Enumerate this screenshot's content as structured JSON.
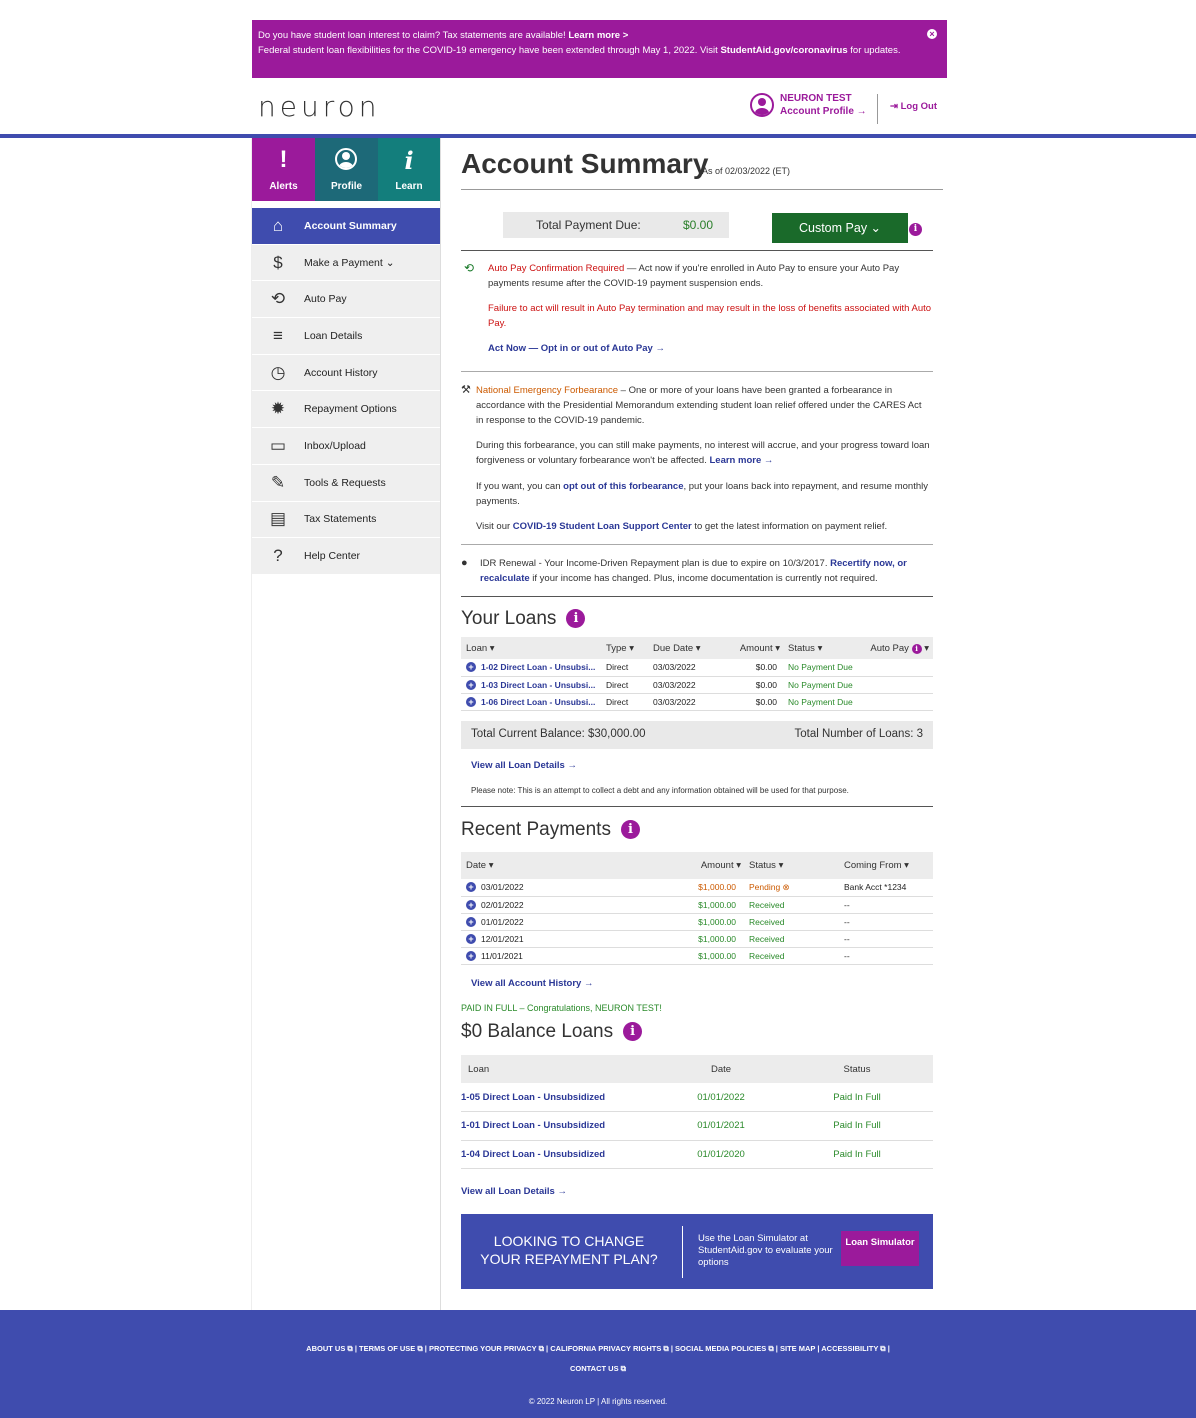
{
  "banner": {
    "line1_text": "Do you have student loan interest to claim? Tax statements are available!",
    "line1_link": "Learn more >",
    "line2_text": "Federal student loan flexibilities for the COVID-19 emergency have been extended through May 1, 2022. Visit",
    "line2_link": "StudentAid.gov/coronavirus",
    "line2_after": "for updates.",
    "close": "×"
  },
  "header": {
    "logo": "neuron",
    "user_name": "NEURON TEST",
    "account_profile": "Account Profile →",
    "logout": "⇥ Log Out"
  },
  "tiles": [
    {
      "label": "Alerts",
      "glyph": "!"
    },
    {
      "label": "Profile"
    },
    {
      "label": "Learn",
      "glyph": "i"
    }
  ],
  "menu": [
    {
      "label": "Account Summary",
      "icon": "⌂"
    },
    {
      "label": "Make a Payment ⌄",
      "icon": "$"
    },
    {
      "label": "Auto Pay",
      "icon": "⟲"
    },
    {
      "label": "Loan Details",
      "icon": "≡"
    },
    {
      "label": "Account History",
      "icon": "◷"
    },
    {
      "label": "Repayment Options",
      "icon": "✹"
    },
    {
      "label": "Inbox/Upload",
      "icon": "▭"
    },
    {
      "label": "Tools & Requests",
      "icon": "✎"
    },
    {
      "label": "Tax Statements",
      "icon": "▤"
    },
    {
      "label": "Help Center",
      "icon": "?"
    }
  ],
  "summary": {
    "title": "Account Summary",
    "as_of": "As of 02/03/2022 (ET)",
    "total_due_label": "Total Payment Due:",
    "total_due_value": "$0.00",
    "custom_pay": "Custom Pay ⌄",
    "info": "i"
  },
  "autopay": {
    "title": "Auto Pay Confirmation Required",
    "text": " — Act now if you're enrolled in Auto Pay to ensure your Auto Pay payments resume after the COVID-19 payment suspension ends.",
    "warning": "Failure to act will result in Auto Pay termination and may result in the loss of benefits associated with Auto Pay.",
    "link": "Act Now — Opt in or out of Auto Pay →"
  },
  "forbearance": {
    "title": "National Emergency Forbearance",
    "text1": " – One or more of your loans have been granted a forbearance in accordance with the Presidential Memorandum extending student loan relief offered under the CARES Act in response to the COVID-19 pandemic.",
    "text2": "During this forbearance, you can still make payments, no interest will accrue, and your progress toward loan forgiveness or voluntary forbearance won't be affected.",
    "learn_more": "Learn more →",
    "text3a": "If you want, you can",
    "opt_out": "opt out of this forbearance",
    "text3b": ", put your loans back into repayment, and resume monthly payments.",
    "text4a": "Visit our",
    "support_link": "COVID-19 Student Loan Support Center",
    "text4b": "to get the latest information on payment relief."
  },
  "idr": {
    "text": "IDR Renewal - Your Income-Driven Repayment plan is due to expire on 10/3/2017.",
    "link": "Recertify now, or recalculate",
    "after": "if your income has changed. Plus, income documentation is currently not required."
  },
  "your_loans": {
    "heading": "Your Loans",
    "columns": [
      "Loan ▾",
      "Type ▾",
      "Due Date ▾",
      "Amount ▾",
      "Status ▾",
      "Auto Pay"
    ],
    "rows": [
      {
        "loan": "1-02 Direct Loan - Unsubsi...",
        "type": "Direct",
        "due": "03/03/2022",
        "amount": "$0.00",
        "status": "No Payment Due"
      },
      {
        "loan": "1-03 Direct Loan - Unsubsi...",
        "type": "Direct",
        "due": "03/03/2022",
        "amount": "$0.00",
        "status": "No Payment Due"
      },
      {
        "loan": "1-06 Direct Loan - Unsubsi...",
        "type": "Direct",
        "due": "03/03/2022",
        "amount": "$0.00",
        "status": "No Payment Due"
      }
    ],
    "balance_label": "Total Current Balance:  $30,000.00",
    "count_label": "Total Number of Loans:  3",
    "view_all": "View all Loan Details →",
    "note": "Please note: This is an attempt to collect a debt and any information obtained will be used for that purpose."
  },
  "recent_payments": {
    "heading": "Recent Payments",
    "columns": [
      "Date ▾",
      "Amount ▾",
      "Status ▾",
      "Coming From ▾"
    ],
    "rows": [
      {
        "date": "03/01/2022",
        "amount": "$1,000.00",
        "status": "Pending ⊗",
        "from": "Bank Acct *1234"
      },
      {
        "date": "02/01/2022",
        "amount": "$1,000.00",
        "status": "Received",
        "from": "--"
      },
      {
        "date": "01/01/2022",
        "amount": "$1,000.00",
        "status": "Received",
        "from": "--"
      },
      {
        "date": "12/01/2021",
        "amount": "$1,000.00",
        "status": "Received",
        "from": "--"
      },
      {
        "date": "11/01/2021",
        "amount": "$1,000.00",
        "status": "Received",
        "from": "--"
      }
    ],
    "view_all": "View all Account History →"
  },
  "zero_balance": {
    "paid_msg": "PAID IN FULL – Congratulations, NEURON TEST!",
    "heading": "$0 Balance Loans",
    "columns": [
      "Loan",
      "Date",
      "Status"
    ],
    "rows": [
      {
        "loan": "1-05 Direct Loan - Unsubsidized",
        "date": "01/01/2022",
        "status": "Paid In Full"
      },
      {
        "loan": "1-01 Direct Loan - Unsubsidized",
        "date": "01/01/2021",
        "status": "Paid In Full"
      },
      {
        "loan": "1-04 Direct Loan - Unsubsidized",
        "date": "01/01/2020",
        "status": "Paid In Full"
      }
    ],
    "view_all": "View all Loan Details →"
  },
  "promo": {
    "headline": "LOOKING TO CHANGE YOUR REPAYMENT PLAN?",
    "text": "Use the Loan Simulator at StudentAid.gov to evaluate your options",
    "button": "Loan Simulator"
  },
  "footer": {
    "links_line1": "ABOUT US ⧉  |  TERMS OF USE ⧉  |  PROTECTING YOUR PRIVACY ⧉  |  CALIFORNIA PRIVACY RIGHTS ⧉  |  SOCIAL MEDIA POLICIES ⧉  |  SITE MAP  |  ACCESSIBILITY ⧉  |",
    "links_line2": "CONTACT US ⧉",
    "copyright": "© 2022 Neuron LP | All rights reserved."
  }
}
